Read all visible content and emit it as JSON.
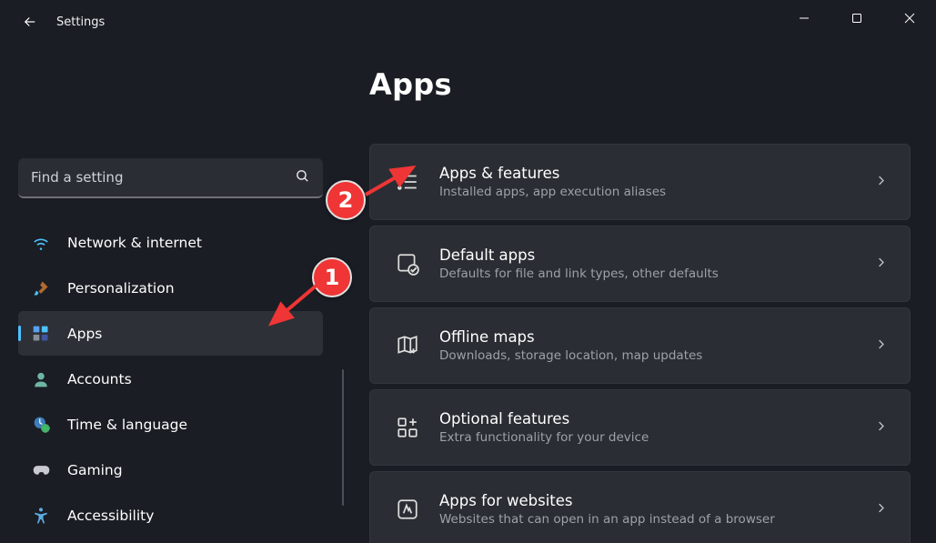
{
  "window": {
    "title": "Settings"
  },
  "search": {
    "placeholder": "Find a setting"
  },
  "sidebar": {
    "items": [
      {
        "label": "Network & internet",
        "icon": "wifi",
        "active": false
      },
      {
        "label": "Personalization",
        "icon": "brush",
        "active": false
      },
      {
        "label": "Apps",
        "icon": "apps",
        "active": true
      },
      {
        "label": "Accounts",
        "icon": "person",
        "active": false
      },
      {
        "label": "Time & language",
        "icon": "clock-globe",
        "active": false
      },
      {
        "label": "Gaming",
        "icon": "gamepad",
        "active": false
      },
      {
        "label": "Accessibility",
        "icon": "accessibility",
        "active": false
      }
    ]
  },
  "main": {
    "heading": "Apps",
    "cards": [
      {
        "title": "Apps & features",
        "subtitle": "Installed apps, app execution aliases",
        "icon": "list"
      },
      {
        "title": "Default apps",
        "subtitle": "Defaults for file and link types, other defaults",
        "icon": "checkbox-app"
      },
      {
        "title": "Offline maps",
        "subtitle": "Downloads, storage location, map updates",
        "icon": "map"
      },
      {
        "title": "Optional features",
        "subtitle": "Extra functionality for your device",
        "icon": "grid-plus"
      },
      {
        "title": "Apps for websites",
        "subtitle": "Websites that can open in an app instead of a browser",
        "icon": "web-app"
      }
    ]
  },
  "annotations": {
    "badge1": "1",
    "badge2": "2"
  }
}
